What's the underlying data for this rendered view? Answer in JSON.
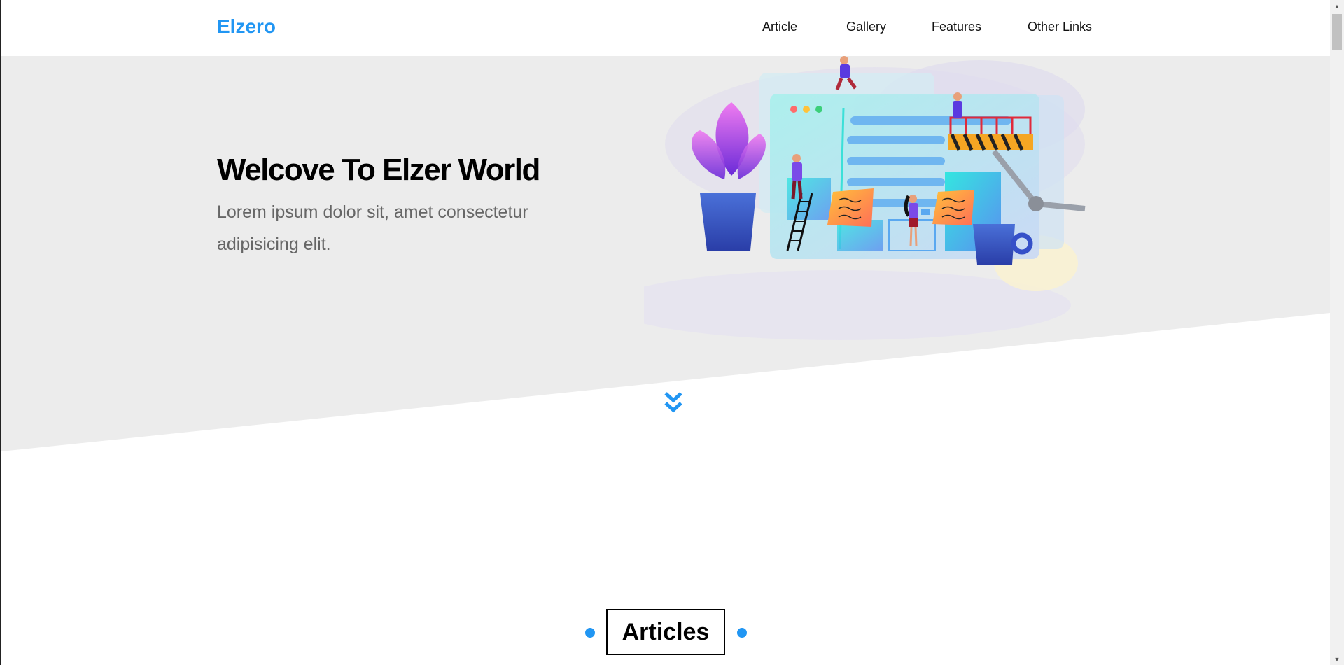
{
  "header": {
    "logo": "Elzero",
    "nav": [
      {
        "label": "Article"
      },
      {
        "label": "Gallery"
      },
      {
        "label": "Features"
      },
      {
        "label": "Other Links"
      }
    ]
  },
  "hero": {
    "title": "Welcove To Elzer World",
    "text": "Lorem ipsum dolor sit, amet consectetur adipisicing elit.",
    "illustration_icon": "website-building-illustration",
    "scroll_icon": "double-chevron-down-icon"
  },
  "articles": {
    "title": "Articles"
  },
  "colors": {
    "accent": "#2196f3",
    "hero_background": "#ececec",
    "text_dark": "#000000",
    "text_muted": "#666666"
  }
}
